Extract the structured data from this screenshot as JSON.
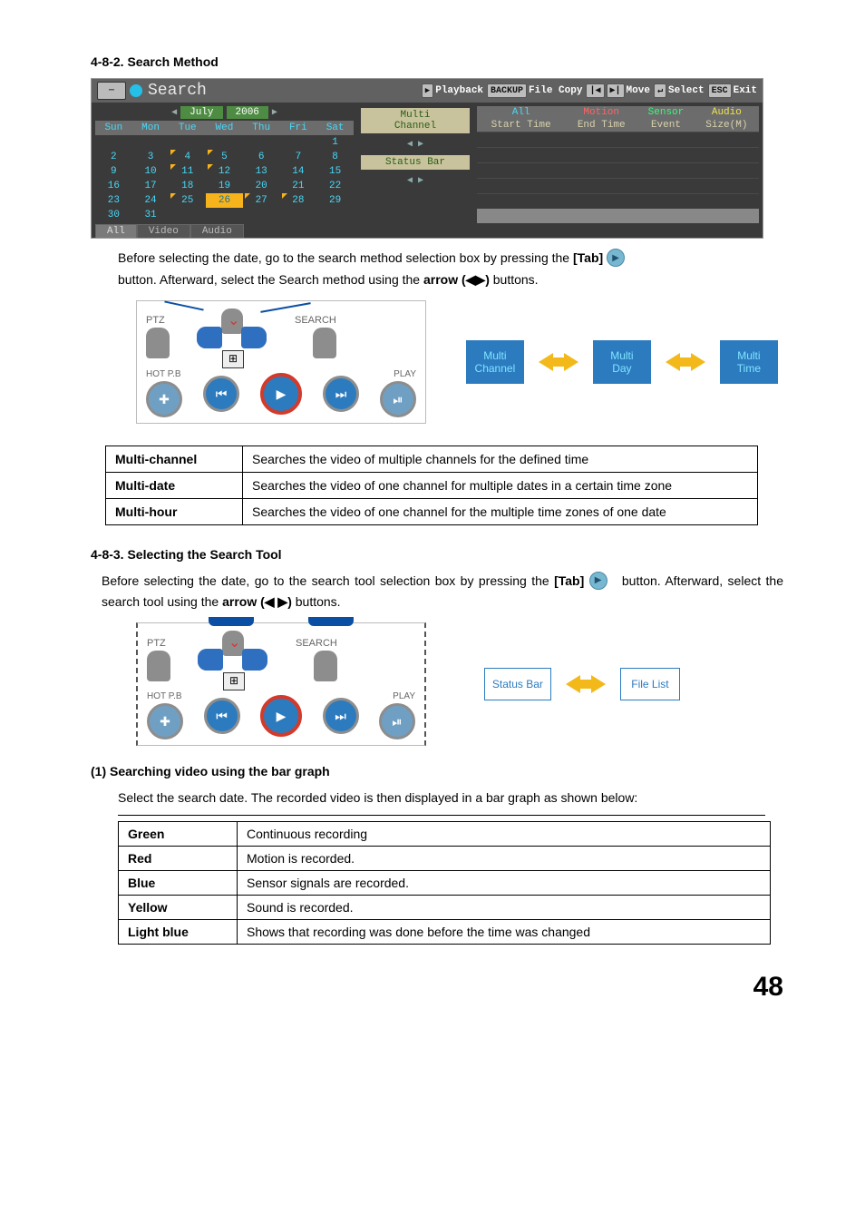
{
  "section482": {
    "title": "4-8-2. Search Method",
    "para_before": "Before selecting the date, go to the search method selection box by pressing the ",
    "tab_key": "[Tab]",
    "para_mid": "button.  Afterward, select the Search method using the ",
    "arrow_key": "arrow (◀▶)",
    "para_after": " buttons."
  },
  "dvr": {
    "title": "Search",
    "hints": {
      "playback": "Playback",
      "backup": "BACKUP",
      "filecopy": "File Copy",
      "move": "Move",
      "select": "Select",
      "esc": "ESC",
      "exit": "Exit"
    },
    "calendar": {
      "month": "July",
      "year": "2006",
      "dow": [
        "Sun",
        "Mon",
        "Tue",
        "Wed",
        "Thu",
        "Fri",
        "Sat"
      ],
      "grid": [
        [
          "",
          "",
          "",
          "",
          "",
          "",
          "1"
        ],
        [
          "2",
          "3",
          "4",
          "5",
          "6",
          "7",
          "8"
        ],
        [
          "9",
          "10",
          "11",
          "12",
          "13",
          "14",
          "15"
        ],
        [
          "16",
          "17",
          "18",
          "19",
          "20",
          "21",
          "22"
        ],
        [
          "23",
          "24",
          "25",
          "26",
          "27",
          "28",
          "29"
        ],
        [
          "30",
          "31",
          "",
          "",
          "",
          "",
          ""
        ]
      ],
      "recDays": [
        "4",
        "5",
        "11",
        "12",
        "25",
        "26",
        "27",
        "28"
      ],
      "selected": "26",
      "tabs": {
        "all": "All",
        "video": "Video",
        "audio": "Audio"
      }
    },
    "mid": {
      "multi_line1": "Multi",
      "multi_line2": "Channel",
      "status": "Status Bar"
    },
    "filelist": {
      "top": {
        "all": "All",
        "motion": "Motion",
        "sensor": "Sensor",
        "audio": "Audio"
      },
      "sub": {
        "start": "Start Time",
        "end": "End Time",
        "event": "Event",
        "size": "Size(M)"
      }
    }
  },
  "remote": {
    "ptz": "PTZ",
    "search": "SEARCH",
    "hotpb": "HOT P.B",
    "play": "PLAY"
  },
  "flow1": {
    "b1a": "Multi",
    "b1b": "Channel",
    "b2a": "Multi",
    "b2b": "Day",
    "b3a": "Multi",
    "b3b": "Time"
  },
  "methodTable": {
    "r1k": "Multi-channel",
    "r1v": "Searches the video of multiple channels for the defined time",
    "r2k": "Multi-date",
    "r2v": "Searches the video of one channel for multiple dates in a certain time zone",
    "r3k": "Multi-hour",
    "r3v": "Searches the video of one channel for the multiple time zones of one date"
  },
  "section483": {
    "title": "4-8-3. Selecting the Search Tool",
    "para_before": "Before selecting the date, go to the search tool selection box by pressing the ",
    "tab_key": "[Tab]",
    "button_word": "button.",
    "para_mid": "Afterward, select the search tool using the ",
    "arrow_key": "arrow (◀ ▶)",
    "para_after": " buttons."
  },
  "flow2": {
    "b1": "Status Bar",
    "b2": "File List"
  },
  "bar": {
    "title": "(1) Searching video using the bar graph",
    "intro": "Select the search date.  The recorded video is then displayed in a bar graph as shown below:",
    "rows": [
      {
        "k": "Green",
        "v": "Continuous recording"
      },
      {
        "k": "Red",
        "v": "Motion is recorded."
      },
      {
        "k": "Blue",
        "v": "Sensor signals are recorded."
      },
      {
        "k": "Yellow",
        "v": "Sound is recorded."
      },
      {
        "k": "Light blue",
        "v": "Shows that recording was done before the time was changed"
      }
    ]
  },
  "pageNumber": "48"
}
